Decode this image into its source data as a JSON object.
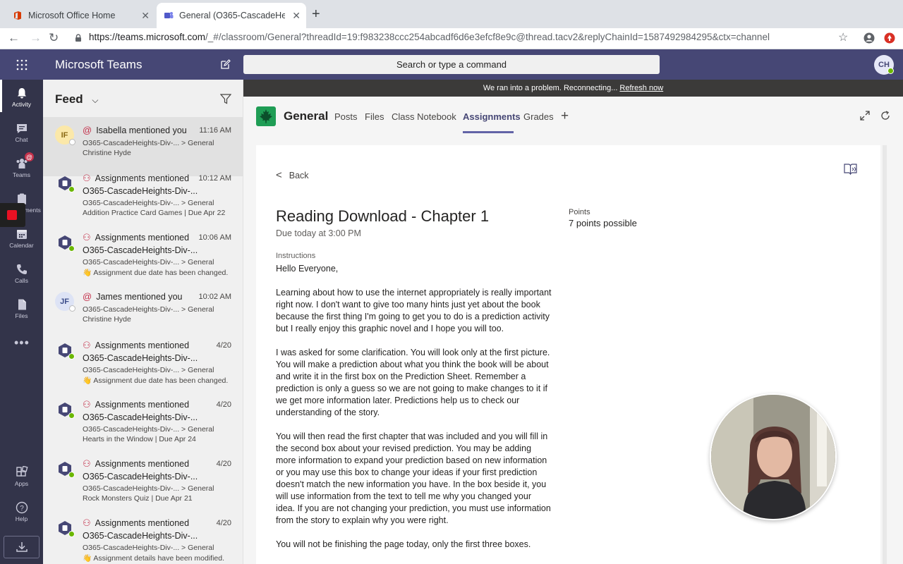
{
  "browser": {
    "tabs": [
      {
        "title": "Microsoft Office Home",
        "active": false
      },
      {
        "title": "General (O365-CascadeHeights-Div-...",
        "active": true
      }
    ],
    "url_host": "https://teams.microsoft.com",
    "url_rest": "/_#/classroom/General?threadId=19:f983238ccc254abcadf6d6e3efcf8e9c@thread.tacv2&replyChainId=1587492984295&ctx=channel"
  },
  "teams": {
    "app_title": "Microsoft Teams",
    "search_placeholder": "Search or type a command",
    "user_initials": "CH"
  },
  "rail": [
    {
      "label": "Activity",
      "icon": "bell-icon"
    },
    {
      "label": "Chat",
      "icon": "chat-icon"
    },
    {
      "label": "Teams",
      "icon": "teams-icon",
      "badge": "@"
    },
    {
      "label": "Assignments",
      "icon": "assignments-icon"
    },
    {
      "label": "Calendar",
      "icon": "calendar-icon"
    },
    {
      "label": "Calls",
      "icon": "phone-icon"
    },
    {
      "label": "Files",
      "icon": "files-icon"
    },
    {
      "label": "Apps",
      "icon": "apps-icon"
    },
    {
      "label": "Help",
      "icon": "help-icon"
    }
  ],
  "feed": {
    "title": "Feed",
    "items": [
      {
        "avatar": "IF",
        "title": "Isabella mentioned you",
        "time": "11:16 AM",
        "line2": "",
        "line3": "O365-CascadeHeights-Div-... > General",
        "line4": "Christine Hyde"
      },
      {
        "avatar": "",
        "title": "Assignments mentioned",
        "time": "10:12 AM",
        "line2": "O365-CascadeHeights-Div-...",
        "line3": "O365-CascadeHeights-Div-... > General",
        "line4": "Addition Practice Card Games | Due Apr 22"
      },
      {
        "avatar": "",
        "title": "Assignments mentioned",
        "time": "10:06 AM",
        "line2": "O365-CascadeHeights-Div-...",
        "line3": "O365-CascadeHeights-Div-... > General",
        "line4": "👋 Assignment due date has been changed."
      },
      {
        "avatar": "JF",
        "title": "James mentioned you",
        "time": "10:02 AM",
        "line2": "",
        "line3": "O365-CascadeHeights-Div-... > General",
        "line4": "Christine Hyde"
      },
      {
        "avatar": "",
        "title": "Assignments mentioned",
        "time": "4/20",
        "line2": "O365-CascadeHeights-Div-...",
        "line3": "O365-CascadeHeights-Div-... > General",
        "line4": "👋 Assignment due date has been changed."
      },
      {
        "avatar": "",
        "title": "Assignments mentioned",
        "time": "4/20",
        "line2": "O365-CascadeHeights-Div-...",
        "line3": "O365-CascadeHeights-Div-... > General",
        "line4": "Hearts in the Window | Due Apr 24"
      },
      {
        "avatar": "",
        "title": "Assignments mentioned",
        "time": "4/20",
        "line2": "O365-CascadeHeights-Div-...",
        "line3": "O365-CascadeHeights-Div-... > General",
        "line4": "Rock Monsters Quiz | Due Apr 21"
      },
      {
        "avatar": "",
        "title": "Assignments mentioned",
        "time": "4/20",
        "line2": "O365-CascadeHeights-Div-...",
        "line3": "O365-CascadeHeights-Div-... > General",
        "line4": "👋 Assignment details have been modified."
      }
    ]
  },
  "banner": {
    "text": "We ran into a problem. Reconnecting...",
    "link": "Refresh now"
  },
  "channel": {
    "name": "General",
    "tabs": [
      "Posts",
      "Files",
      "Class Notebook",
      "Assignments",
      "Grades"
    ],
    "active_tab": "Assignments"
  },
  "assignment": {
    "back_label": "Back",
    "title": "Reading Download - Chapter 1",
    "due": "Due today at 3:00 PM",
    "points_label": "Points",
    "points_value": "7 points possible",
    "instructions_label": "Instructions",
    "paragraphs": [
      "Hello Everyone,",
      "Learning about how to use the internet appropriately is really important right now.  I don't want to give too many hints just yet about the book because the first thing I'm going to get you to do is a prediction activity but I really enjoy this graphic novel and I hope you will too.",
      "I was asked for some clarification.  You will look only at the first picture.  You will make a prediction about what you think the book will be about and write it in the first box on the Prediction Sheet.  Remember a prediction is only a guess so we are not going to make changes to it if we get more information later.    Predictions help us to check our understanding of the story.",
      "You will then read the first chapter that was included and you will fill in the second box about your revised prediction.  You may be adding more information to expand your prediction based on new information or you may use this box to change your ideas if your first prediction doesn't match the new information you have.  In the box beside it, you will use information from the text to tell me why you changed your idea.  If you are not changing your prediction, you must use information from the story to explain why you were right.",
      "You will not be finishing the page today, only the first three boxes."
    ]
  },
  "colors": {
    "teams_purple": "#464775",
    "rail": "#33344a",
    "accent": "#6264a7"
  }
}
